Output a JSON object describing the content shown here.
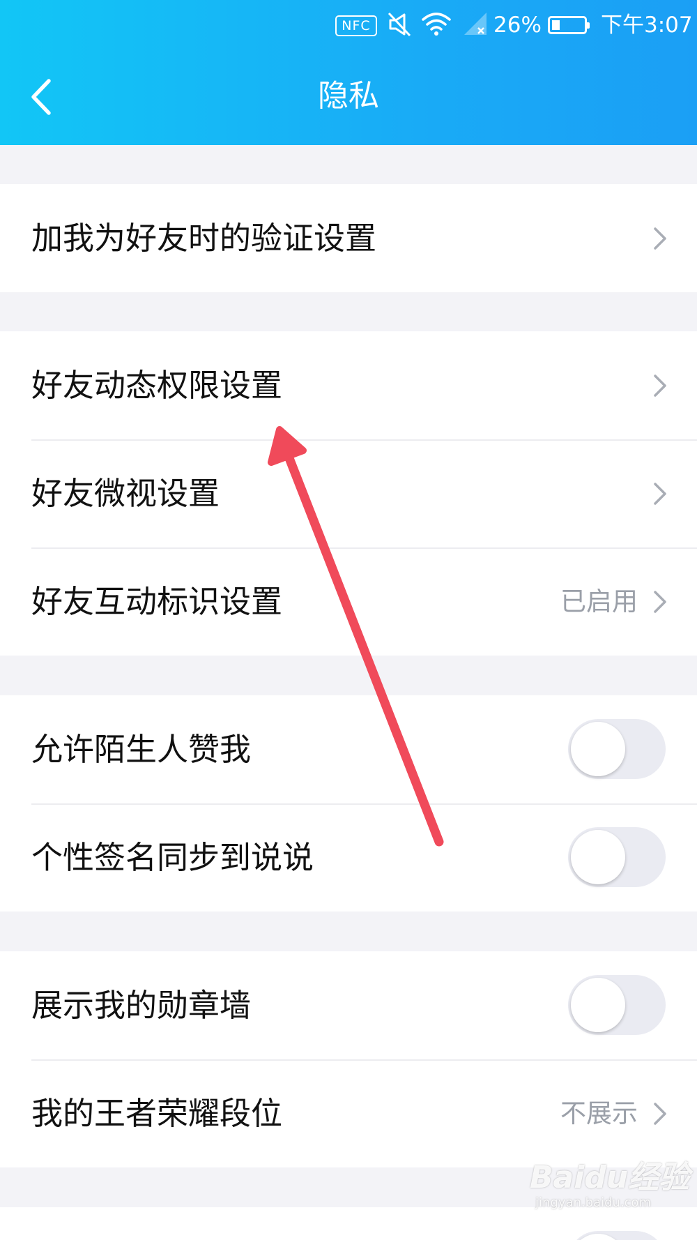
{
  "status_bar": {
    "nfc_label": "NFC",
    "battery_percent": "26%",
    "battery_level": 0.26,
    "time": "下午3:07",
    "icons": [
      "nfc-icon",
      "mute-icon",
      "wifi-icon",
      "signal-icon",
      "battery-icon"
    ]
  },
  "header": {
    "back_icon": "back-arrow-icon",
    "title": "隐私",
    "gradient_start": "#12c6f6",
    "gradient_end": "#1b9ff5"
  },
  "sections": [
    {
      "rows": [
        {
          "label": "加我为好友时的验证设置",
          "type": "link"
        }
      ]
    },
    {
      "rows": [
        {
          "label": "好友动态权限设置",
          "type": "link"
        },
        {
          "label": "好友微视设置",
          "type": "link"
        },
        {
          "label": "好友互动标识设置",
          "type": "link",
          "value": "已启用"
        }
      ]
    },
    {
      "rows": [
        {
          "label": "允许陌生人赞我",
          "type": "toggle",
          "on": false
        },
        {
          "label": "个性签名同步到说说",
          "type": "toggle",
          "on": false
        }
      ]
    },
    {
      "rows": [
        {
          "label": "展示我的勋章墙",
          "type": "toggle",
          "on": false
        },
        {
          "label": "我的王者荣耀段位",
          "type": "link",
          "value": "不展示"
        }
      ]
    }
  ],
  "annotation": {
    "color": "#f04a5a",
    "points_to": "好友动态权限设置"
  },
  "watermark": {
    "brand": "Baidu经验",
    "site": "jingyan.baidu.com"
  }
}
